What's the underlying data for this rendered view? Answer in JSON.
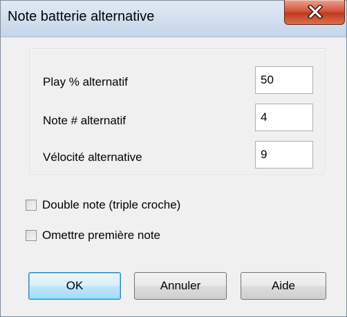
{
  "window": {
    "title": "Note batterie alternative",
    "close_icon": "close-icon"
  },
  "fields": [
    {
      "label": "Play % alternatif",
      "value": "50"
    },
    {
      "label": "Note # alternatif",
      "value": "4"
    },
    {
      "label": "Vélocité alternative",
      "value": "9"
    }
  ],
  "checkboxes": [
    {
      "label": "Double note (triple croche)",
      "checked": false
    },
    {
      "label": "Omettre première note",
      "checked": false
    }
  ],
  "buttons": {
    "ok": "OK",
    "cancel": "Annuler",
    "help": "Aide"
  },
  "colors": {
    "dialog_bg": "#f0f0f0",
    "titlebar": "#cfdeee",
    "close_button": "#c94a30",
    "default_button_border": "#3c7fb1"
  }
}
